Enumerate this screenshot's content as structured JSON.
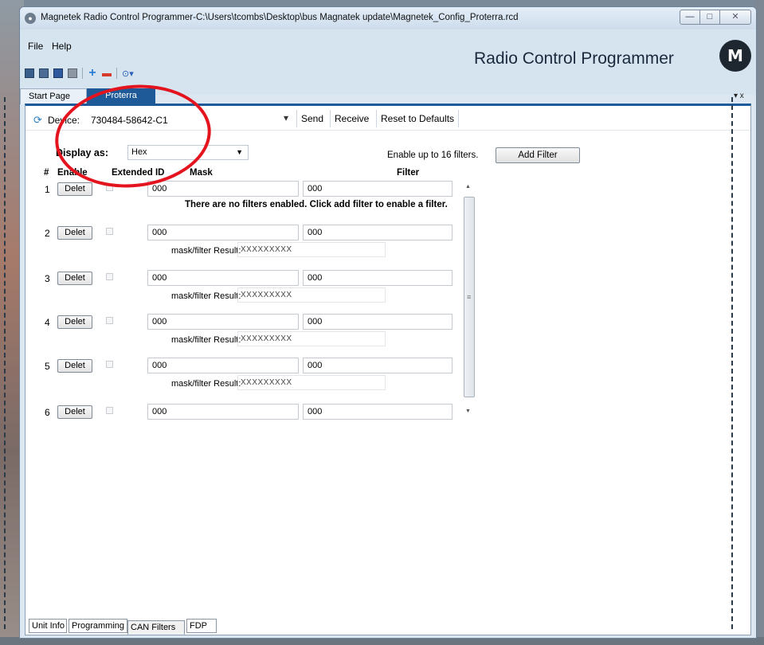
{
  "window": {
    "title": "Magnetek Radio Control Programmer-C:\\Users\\tcombs\\Desktop\\bus Magnatek update\\Magnetek_Config_Proterra.rcd",
    "minimize": "—",
    "maximize": "□",
    "close": "✕"
  },
  "menu": {
    "file": "File",
    "help": "Help"
  },
  "brand": {
    "title": "Radio Control Programmer",
    "logo": "M"
  },
  "doc_tabs": {
    "start": "Start Page",
    "proterra": "Proterra",
    "menu": "▾ x"
  },
  "device": {
    "label": "Device:",
    "value": "730484-58642-C1",
    "dropdown": "▾",
    "send": "Send",
    "receive": "Receive",
    "reset": "Reset to Defaults"
  },
  "display": {
    "label": "Display as:",
    "value": "Hex"
  },
  "enable_text": "Enable up to 16 filters.",
  "add_filter": "Add Filter",
  "headers": {
    "num": "#",
    "enable": "Enable",
    "extended": "Extended ID",
    "mask": "Mask",
    "filter": "Filter"
  },
  "rows": [
    {
      "num": "1",
      "delete": "Delet",
      "mask": "000",
      "filter": "000",
      "result_label": "",
      "result": "",
      "message": "There are no filters enabled. Click add filter to enable a filter."
    },
    {
      "num": "2",
      "delete": "Delet",
      "mask": "000",
      "filter": "000",
      "result_label": "mask/filter Result:",
      "result": "XXXXXXXXX",
      "message": ""
    },
    {
      "num": "3",
      "delete": "Delet",
      "mask": "000",
      "filter": "000",
      "result_label": "mask/filter Result:",
      "result": "XXXXXXXXX",
      "message": ""
    },
    {
      "num": "4",
      "delete": "Delet",
      "mask": "000",
      "filter": "000",
      "result_label": "mask/filter Result:",
      "result": "XXXXXXXXX",
      "message": ""
    },
    {
      "num": "5",
      "delete": "Delet",
      "mask": "000",
      "filter": "000",
      "result_label": "mask/filter Result:",
      "result": "XXXXXXXXX",
      "message": ""
    },
    {
      "num": "6",
      "delete": "Delet",
      "mask": "000",
      "filter": "000",
      "result_label": "",
      "result": "",
      "message": ""
    }
  ],
  "bottom_tabs": {
    "unit": "Unit Info",
    "programming": "Programming",
    "can": "CAN Filters",
    "fdp": "FDP"
  },
  "icons": {
    "refresh": "refresh-icon",
    "save": "save-icon",
    "add": "plus-icon",
    "remove": "minus-icon",
    "help": "help-icon"
  },
  "colors": {
    "accent": "#1f5a98",
    "annotation": "#e3141e"
  }
}
